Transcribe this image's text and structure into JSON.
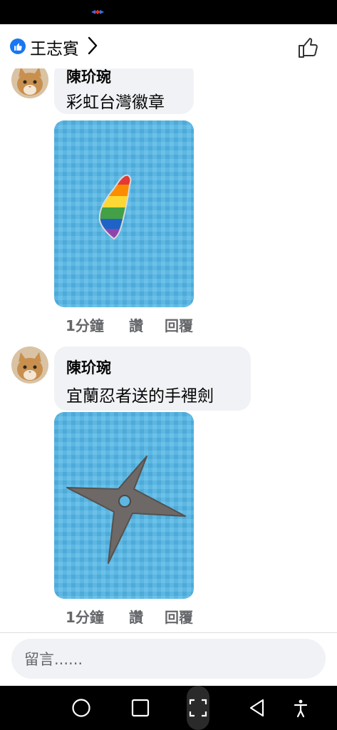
{
  "header": {
    "name": "王志賓"
  },
  "comments": [
    {
      "author": "陳玠琬",
      "text": "彩虹台灣徽章",
      "time": "1分鐘",
      "like_label": "讚",
      "reply_label": "回覆"
    },
    {
      "author": "陳玠琬",
      "text": "宜蘭忍者送的手裡劍",
      "time": "1分鐘",
      "like_label": "讚",
      "reply_label": "回覆"
    }
  ],
  "composer": {
    "placeholder": "留言......"
  },
  "icons": {
    "header": [
      "like-badge-icon",
      "chevron-right-icon",
      "thumbs-up-icon"
    ],
    "navbar": [
      "home-circle-icon",
      "recents-square-icon",
      "screenshot-frame-icon",
      "back-triangle-icon",
      "accessibility-icon"
    ]
  },
  "colors": {
    "facebook_blue": "#1877f2",
    "bubble_gray": "#f0f2f5",
    "meta_gray": "#65676b",
    "photo_blue": "#5bb6e0"
  }
}
